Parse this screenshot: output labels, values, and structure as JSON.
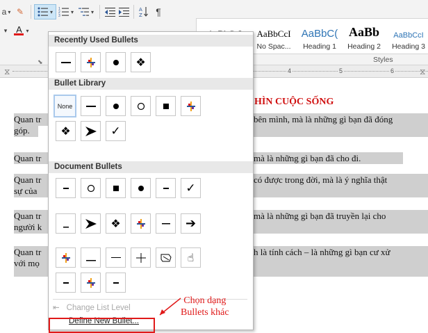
{
  "ribbon": {
    "row1": {
      "dropdown_a": "a",
      "sort_icon": "sort-icon",
      "pilcrow": "¶"
    },
    "row2": {
      "font_color_letter": "A"
    },
    "styles": [
      {
        "sample": "AaBbCcI",
        "name": ""
      },
      {
        "sample": "AaBbCcI",
        "name": "No Spac..."
      },
      {
        "sample": "AaBbC(",
        "name": "Heading 1"
      },
      {
        "sample": "AaBb",
        "name": "Heading 2"
      },
      {
        "sample": "AaBbCcI",
        "name": "Heading 3"
      }
    ],
    "styles_label": "Styles",
    "ruler_marks": [
      "4",
      "5",
      "6"
    ]
  },
  "document": {
    "title": "HÌN CUỘC SỐNG",
    "paragraphs": [
      {
        "left_line1": "Quan tr",
        "right_line1": "bên mình, mà là những gì bạn đã đóng",
        "left_line2": "góp."
      },
      {
        "left_line1": "Quan tr",
        "right_line1": "mà là những gì bạn đã cho đi."
      },
      {
        "left_line1": "Quan tr",
        "right_line1": "có được trong đời, mà là ý nghĩa thật",
        "left_line2": "sự của"
      },
      {
        "left_line1": "Quan tr",
        "right_line1": "mà là những gì bạn đã truyền lại cho",
        "left_line2": "người k"
      },
      {
        "left_line1": "Quan tr",
        "right_line1": "h là tính cách – là những gì bạn cư xử",
        "left_line2": "với mọ"
      }
    ]
  },
  "dropdown": {
    "recently_used_header": "Recently Used Bullets",
    "library_header": "Bullet Library",
    "document_bullets_header": "Document Bullets",
    "none_label": "None",
    "change_list_level": "Change List Level",
    "define_new_bullet": "Define New Bullet..."
  },
  "annotation": {
    "line1": "Chọn dạng",
    "line2": "Bullets khác",
    "color": "#e01919"
  }
}
